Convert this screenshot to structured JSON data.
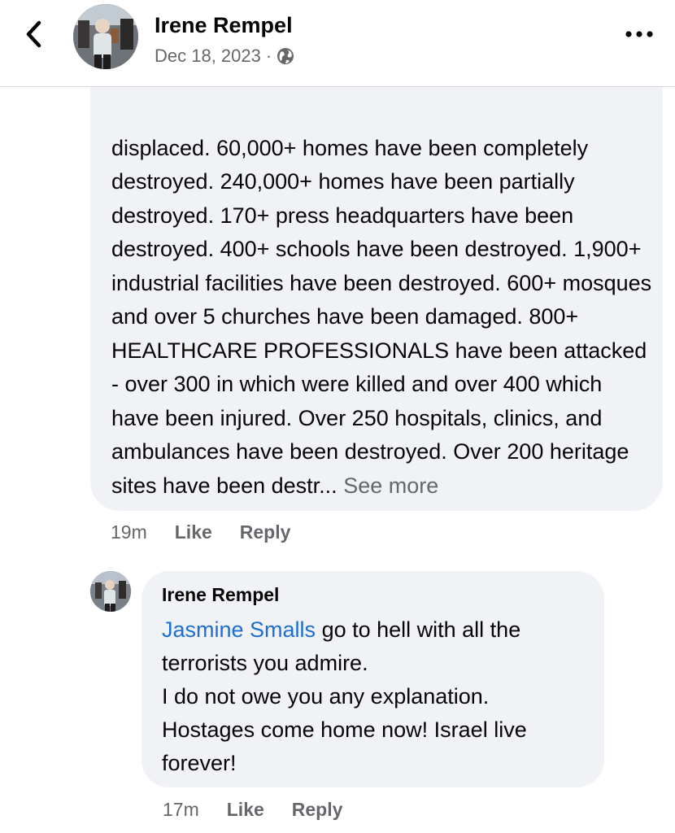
{
  "header": {
    "back_icon": "chevron-left-icon",
    "author_name": "Irene Rempel",
    "date": "Dec 18, 2023",
    "separator": "·",
    "privacy_icon": "globe-icon",
    "more_icon": "more-horizontal-icon"
  },
  "comment": {
    "text": "displaced. 60,000+ homes have been completely destroyed. 240,000+ homes have been partially destroyed. 170+ press headquarters have been destroyed. 400+ schools have been destroyed. 1,900+ industrial facilities have been destroyed. 600+ mosques and over 5 churches have been damaged. 800+ HEALTHCARE PROFESSIONALS have been attacked - over 300 in which were killed and over 400 which have been injured. Over 250 hospitals, clinics, and ambulances have been destroyed. Over 200 heritage sites have been destr...",
    "see_more": "See more",
    "time": "19m",
    "like": "Like",
    "reply": "Reply"
  },
  "reply": {
    "author": "Irene Rempel",
    "mention": "Jasmine Smalls",
    "text": " go to hell with all the terrorists you admire.\nI do not owe you any explanation.\nHostages come home now! Israel live forever!",
    "time": "17m",
    "like": "Like",
    "reply": "Reply"
  },
  "colors": {
    "bubble": "#f0f2f5",
    "mention": "#1c6fd0",
    "secondary_text": "#65676b"
  }
}
